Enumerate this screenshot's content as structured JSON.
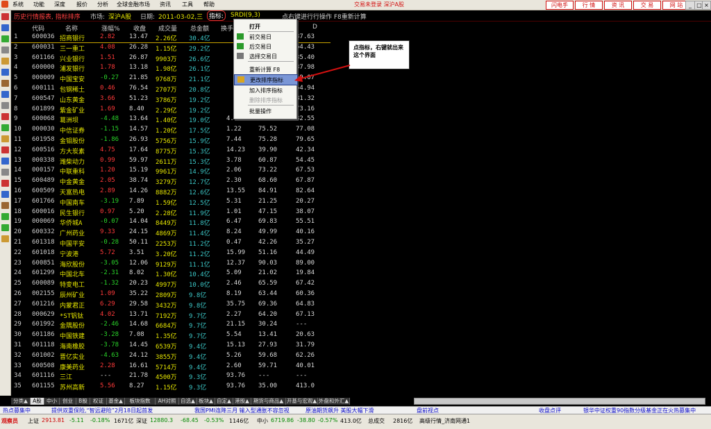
{
  "menu": {
    "items": [
      "系统",
      "功能",
      "深度",
      "报价",
      "分析",
      "全球金融市场",
      "资讯",
      "工具",
      "帮助"
    ],
    "status": "交易未登录  深沪A股",
    "right_buttons": [
      "闪电手",
      "行 情",
      "资 讯",
      "交 易",
      "网 站"
    ],
    "window_controls": [
      "_",
      "□",
      "×"
    ]
  },
  "infobar": {
    "title": "历史行情报表, 指标排序",
    "market_label": "市场:",
    "market_value": "深沪A股",
    "date_label": "日期:",
    "date_value": "2011-03-02,三",
    "indicator_label": "指标:",
    "indicator_value": "SRDI(9,3)",
    "hint": "点右键进行行操作  F8重新计算"
  },
  "table": {
    "headers": [
      "代码",
      "名称",
      "涨幅%",
      "收盘",
      "成交量",
      "总金额",
      "换手",
      "",
      "D"
    ],
    "rows": [
      {
        "i": "1",
        "code": "600036",
        "name": "招商银行",
        "chg": "2.82",
        "close": "13.47",
        "vol": "2.26亿",
        "amt": "30.4亿",
        "c7": "",
        "c8": "",
        "d": "37.63",
        "up": true
      },
      {
        "i": "2",
        "code": "600031",
        "name": "三一重工",
        "chg": "4.08",
        "close": "26.28",
        "vol": "1.15亿",
        "amt": "29.2亿",
        "c7": "",
        "c8": "",
        "d": "64.43",
        "up": true
      },
      {
        "i": "3",
        "code": "601166",
        "name": "兴业银行",
        "chg": "1.51",
        "close": "26.87",
        "vol": "9903万",
        "amt": "26.6亿",
        "c7": "",
        "c8": "",
        "d": "35.40",
        "up": true
      },
      {
        "i": "4",
        "code": "600000",
        "name": "浦发银行",
        "chg": "1.78",
        "close": "13.18",
        "vol": "1.98亿",
        "amt": "26.1亿",
        "c7": "",
        "c8": "",
        "d": "37.98",
        "up": true
      },
      {
        "i": "5",
        "code": "000009",
        "name": "中国宝安",
        "chg": "-0.27",
        "close": "21.85",
        "vol": "9768万",
        "amt": "21.1亿",
        "c7": "",
        "c8": "",
        "d": "59.07",
        "up": false
      },
      {
        "i": "6",
        "code": "600111",
        "name": "包钢稀土",
        "chg": "0.46",
        "close": "76.54",
        "vol": "2707万",
        "amt": "20.8亿",
        "c7": "",
        "c8": "",
        "d": "54.94",
        "up": true
      },
      {
        "i": "7",
        "code": "600547",
        "name": "山东黄金",
        "chg": "3.66",
        "close": "51.23",
        "vol": "3786万",
        "amt": "19.2亿",
        "c7": "",
        "c8": "",
        "d": "81.32",
        "up": true
      },
      {
        "i": "8",
        "code": "601899",
        "name": "紫金矿业",
        "chg": "1.69",
        "close": "8.40",
        "vol": "2.29亿",
        "amt": "19.2亿",
        "c7": "",
        "c8": "",
        "d": "73.16",
        "up": true
      },
      {
        "i": "9",
        "code": "600068",
        "name": "葛洲坝",
        "chg": "-4.48",
        "close": "13.64",
        "vol": "1.40亿",
        "amt": "19.0亿",
        "c7": "4.03",
        "c8": "32.79",
        "d": "32.55",
        "up": false
      },
      {
        "i": "10",
        "code": "000030",
        "name": "中信证券",
        "chg": "-1.15",
        "close": "14.57",
        "vol": "1.20亿",
        "amt": "17.5亿",
        "c7": "1.22",
        "c8": "75.52",
        "d": "77.08",
        "up": false
      },
      {
        "i": "11",
        "code": "601958",
        "name": "金钼股份",
        "chg": "-1.86",
        "close": "26.93",
        "vol": "5756万",
        "amt": "15.9亿",
        "c7": "7.44",
        "c8": "75.28",
        "d": "79.65",
        "up": false
      },
      {
        "i": "12",
        "code": "600516",
        "name": "方大炭素",
        "chg": "4.75",
        "close": "17.64",
        "vol": "8775万",
        "amt": "15.3亿",
        "c7": "14.23",
        "c8": "39.90",
        "d": "42.34",
        "up": true
      },
      {
        "i": "13",
        "code": "000338",
        "name": "潍柴动力",
        "chg": "0.99",
        "close": "59.97",
        "vol": "2611万",
        "amt": "15.3亿",
        "c7": "3.78",
        "c8": "60.87",
        "d": "54.45",
        "up": true
      },
      {
        "i": "14",
        "code": "000157",
        "name": "中联重科",
        "chg": "1.20",
        "close": "15.19",
        "vol": "9961万",
        "amt": "14.9亿",
        "c7": "2.06",
        "c8": "73.22",
        "d": "67.53",
        "up": true
      },
      {
        "i": "15",
        "code": "600489",
        "name": "中金黄金",
        "chg": "2.05",
        "close": "38.74",
        "vol": "3279万",
        "amt": "12.7亿",
        "c7": "2.30",
        "c8": "68.60",
        "d": "67.87",
        "up": true
      },
      {
        "i": "16",
        "code": "600509",
        "name": "天富热电",
        "chg": "2.89",
        "close": "14.26",
        "vol": "8882万",
        "amt": "12.6亿",
        "c7": "13.55",
        "c8": "84.91",
        "d": "82.64",
        "up": true
      },
      {
        "i": "17",
        "code": "601766",
        "name": "中国南车",
        "chg": "-3.19",
        "close": "7.89",
        "vol": "1.59亿",
        "amt": "12.5亿",
        "c7": "5.31",
        "c8": "21.25",
        "d": "20.27",
        "up": false
      },
      {
        "i": "18",
        "code": "600016",
        "name": "民生银行",
        "chg": "0.97",
        "close": "5.20",
        "vol": "2.28亿",
        "amt": "11.9亿",
        "c7": "1.01",
        "c8": "47.15",
        "d": "38.07",
        "up": true
      },
      {
        "i": "19",
        "code": "000069",
        "name": "华侨城A",
        "chg": "-0.07",
        "close": "14.04",
        "vol": "8449万",
        "amt": "11.8亿",
        "c7": "6.47",
        "c8": "69.83",
        "d": "55.51",
        "up": false
      },
      {
        "i": "20",
        "code": "600332",
        "name": "广州药业",
        "chg": "9.33",
        "close": "24.15",
        "vol": "4869万",
        "amt": "11.4亿",
        "c7": "8.24",
        "c8": "49.99",
        "d": "40.16",
        "up": true
      },
      {
        "i": "21",
        "code": "601318",
        "name": "中国平安",
        "chg": "-0.28",
        "close": "50.11",
        "vol": "2253万",
        "amt": "11.2亿",
        "c7": "0.47",
        "c8": "42.26",
        "d": "35.27",
        "up": false
      },
      {
        "i": "22",
        "code": "601018",
        "name": "宁波港",
        "chg": "5.72",
        "close": "3.51",
        "vol": "3.20亿",
        "amt": "11.2亿",
        "c7": "15.99",
        "c8": "51.16",
        "d": "44.49",
        "up": true
      },
      {
        "i": "23",
        "code": "600851",
        "name": "海欣股份",
        "chg": "-3.05",
        "close": "12.06",
        "vol": "9129万",
        "amt": "11.1亿",
        "c7": "12.37",
        "c8": "90.03",
        "d": "89.00",
        "up": false
      },
      {
        "i": "24",
        "code": "601299",
        "name": "中国北车",
        "chg": "-2.31",
        "close": "8.02",
        "vol": "1.30亿",
        "amt": "10.4亿",
        "c7": "5.09",
        "c8": "21.02",
        "d": "19.84",
        "up": false
      },
      {
        "i": "25",
        "code": "600089",
        "name": "特变电工",
        "chg": "-1.32",
        "close": "20.23",
        "vol": "4997万",
        "amt": "10.0亿",
        "c7": "2.46",
        "c8": "65.59",
        "d": "67.42",
        "up": false
      },
      {
        "i": "26",
        "code": "002155",
        "name": "辰州矿业",
        "chg": "1.09",
        "close": "35.22",
        "vol": "2809万",
        "amt": "9.8亿",
        "c7": "8.19",
        "c8": "63.44",
        "d": "60.36",
        "up": true
      },
      {
        "i": "27",
        "code": "601216",
        "name": "内蒙君正",
        "chg": "6.29",
        "close": "29.58",
        "vol": "3432万",
        "amt": "9.8亿",
        "c7": "35.75",
        "c8": "69.36",
        "d": "64.83",
        "up": true
      },
      {
        "i": "28",
        "code": "000629",
        "name": "*ST钒钛",
        "chg": "4.02",
        "close": "13.71",
        "vol": "7192万",
        "amt": "9.7亿",
        "c7": "2.27",
        "c8": "64.20",
        "d": "67.13",
        "up": true
      },
      {
        "i": "29",
        "code": "601992",
        "name": "金隅股份",
        "chg": "-2.46",
        "close": "14.68",
        "vol": "6684万",
        "amt": "9.7亿",
        "c7": "21.15",
        "c8": "30.24",
        "d": "---",
        "up": false
      },
      {
        "i": "30",
        "code": "601186",
        "name": "中国铁建",
        "chg": "-3.28",
        "close": "7.08",
        "vol": "1.35亿",
        "amt": "9.7亿",
        "c7": "5.54",
        "c8": "13.41",
        "d": "20.63",
        "up": false
      },
      {
        "i": "31",
        "code": "601118",
        "name": "海南橡胶",
        "chg": "-3.78",
        "close": "14.45",
        "vol": "6539万",
        "amt": "9.4亿",
        "c7": "15.13",
        "c8": "27.93",
        "d": "31.79",
        "up": false
      },
      {
        "i": "32",
        "code": "601002",
        "name": "晋亿实业",
        "chg": "-4.63",
        "close": "24.12",
        "vol": "3855万",
        "amt": "9.4亿",
        "c7": "5.26",
        "c8": "59.68",
        "d": "62.26",
        "up": false
      },
      {
        "i": "33",
        "code": "600508",
        "name": "康美药业",
        "chg": "2.28",
        "close": "16.61",
        "vol": "5714万",
        "amt": "9.4亿",
        "c7": "2.60",
        "c8": "59.71",
        "d": "40.01",
        "up": true
      },
      {
        "i": "34",
        "code": "601116",
        "name": "三江",
        "chg": "---",
        "close": "21.78",
        "vol": "4500万",
        "amt": "9.3亿",
        "c7": "93.76",
        "c8": "---",
        "d": "---",
        "up": null
      },
      {
        "i": "35",
        "code": "601155",
        "name": "苏州高新",
        "chg": "5.56",
        "close": "8.27",
        "vol": "1.15亿",
        "amt": "9.3亿",
        "c7": "93.76",
        "c8": "35.00",
        "d": "413.0",
        "up": true
      }
    ]
  },
  "context_menu": {
    "items": [
      {
        "label": "打开",
        "icon": ""
      },
      {
        "label": "前交易日",
        "icon": "green-left-arrow-icon"
      },
      {
        "label": "后交易日",
        "icon": "green-right-arrow-icon"
      },
      {
        "label": "选择交易日",
        "icon": "calendar-icon"
      },
      {
        "label": "重新计算    F8",
        "icon": ""
      },
      {
        "label": "更改排序指标",
        "icon": "sort-icon",
        "selected": true
      },
      {
        "label": "加入排序指标",
        "icon": ""
      },
      {
        "label": "删除排序指标",
        "icon": "",
        "disabled": true
      },
      {
        "label": "批量操作",
        "icon": ""
      }
    ]
  },
  "callout": {
    "text": "点指标，右键就出来这个界面"
  },
  "tabs": [
    "分类▲",
    "A股",
    "中小",
    "创业",
    "B股",
    "权证",
    "基金▲",
    "板块指数",
    "AH对照",
    "自选▲",
    "板块▲",
    "自定▲",
    "港股▲",
    "期货与商品▲",
    "开基与宏观▲",
    "外盘和外汇▲"
  ],
  "ticker": [
    "热点募集中",
    "提供双重保险,“智远避险”2月18日起首发",
    "我国PMI连降三月 输入型通胀不容忽视",
    "原油期货飙升 美股大幅下滑",
    "盘前视点",
    "收盘点评",
    "银华中证权重90指数分级基金正在火热募集中"
  ],
  "statusbar": {
    "user": "观察员",
    "sh_label": "上证",
    "sh": "2913.81",
    "sh_chg": "-5.11",
    "sh_pct": "-0.18%",
    "sh_amt": "1671亿",
    "sz_label": "深证",
    "sz": "12880.3",
    "sz_chg": "-68.45",
    "sz_pct": "-0.53%",
    "sz_amt": "1146亿",
    "zx_label": "中小",
    "zx": "6719.86",
    "zx_chg": "-38.80",
    "zx_pct": "-0.57%",
    "zx_amt": "413.0亿",
    "total_label": "总成交",
    "total": "2816亿",
    "server": "高级行情_济南网通1"
  },
  "colors": {
    "up": "#ff3a3a",
    "down": "#2ad42a",
    "text": "#d8d8d8",
    "accent": "#d21010"
  }
}
